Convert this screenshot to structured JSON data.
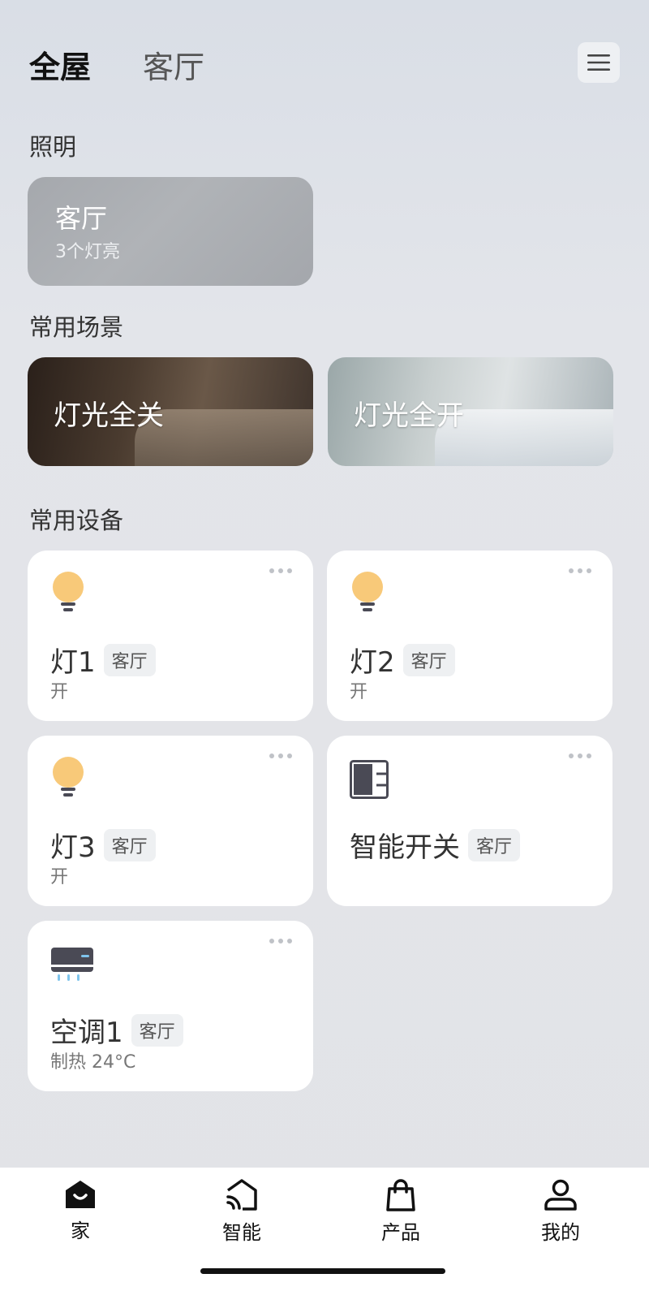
{
  "header": {
    "tabs": [
      {
        "label": "全屋",
        "active": true
      },
      {
        "label": "客厅",
        "active": false
      }
    ],
    "menu_icon": "hamburger-icon"
  },
  "lighting": {
    "section_title": "照明",
    "card": {
      "title": "客厅",
      "subtitle": "3个灯亮"
    }
  },
  "scenes": {
    "section_title": "常用场景",
    "items": [
      {
        "label": "灯光全关"
      },
      {
        "label": "灯光全开"
      }
    ]
  },
  "devices": {
    "section_title": "常用设备",
    "items": [
      {
        "name": "灯1",
        "room": "客厅",
        "status": "开",
        "icon": "bulb-icon"
      },
      {
        "name": "灯2",
        "room": "客厅",
        "status": "开",
        "icon": "bulb-icon"
      },
      {
        "name": "灯3",
        "room": "客厅",
        "status": "开",
        "icon": "bulb-icon"
      },
      {
        "name": "智能开关",
        "room": "客厅",
        "status": "",
        "icon": "switch-panel-icon"
      },
      {
        "name": "空调1",
        "room": "客厅",
        "status": "制热 24°C",
        "icon": "air-conditioner-icon"
      }
    ]
  },
  "bottom_nav": {
    "items": [
      {
        "label": "家",
        "icon": "home-icon",
        "active": true
      },
      {
        "label": "智能",
        "icon": "smart-icon",
        "active": false
      },
      {
        "label": "产品",
        "icon": "shopping-bag-icon",
        "active": false
      },
      {
        "label": "我的",
        "icon": "person-icon",
        "active": false
      }
    ]
  },
  "colors": {
    "bulb": "#f8c979",
    "device_icon_dark": "#4a4a55",
    "ac_blue": "#7fc4ec"
  }
}
